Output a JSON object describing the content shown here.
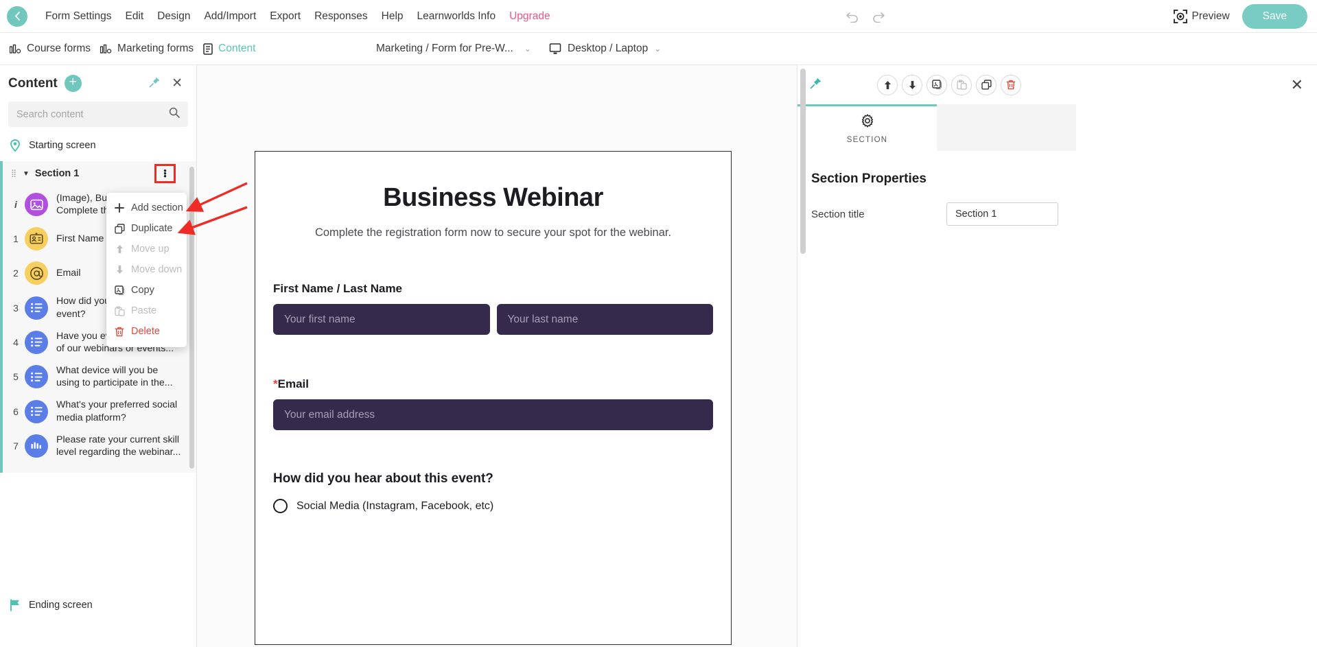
{
  "topbar": {
    "back_icon": "chevron-left-icon",
    "menu": [
      {
        "label": "Form Settings",
        "accent": false
      },
      {
        "label": "Edit",
        "accent": false
      },
      {
        "label": "Design",
        "accent": false
      },
      {
        "label": "Add/Import",
        "accent": false
      },
      {
        "label": "Export",
        "accent": false
      },
      {
        "label": "Responses",
        "accent": false
      },
      {
        "label": "Help",
        "accent": false
      },
      {
        "label": "Learnworlds Info",
        "accent": false
      },
      {
        "label": "Upgrade",
        "accent": true
      }
    ],
    "undo_icon": "undo-icon",
    "redo_icon": "redo-icon",
    "preview_label": "Preview",
    "preview_icon": "preview-focus-icon",
    "save_label": "Save",
    "accent_color": "#79ccc3",
    "upgrade_color": "#f0548c"
  },
  "subbar": {
    "course_forms": "Course forms",
    "marketing_forms": "Marketing forms",
    "content": "Content",
    "form_name": "Marketing / Form for Pre-W...",
    "device": "Desktop / Laptop"
  },
  "left_panel": {
    "title": "Content",
    "add_label": "+",
    "search_placeholder": "Search content",
    "search_value": "",
    "starting_screen": "Starting screen",
    "ending_screen": "Ending screen",
    "section": {
      "name": "Section 1",
      "items": [
        {
          "num": "i",
          "label": "(Image), Business Webinar,\nComplete the registra...",
          "color": "purple",
          "icon": "image-icon"
        },
        {
          "num": "1",
          "label": "First Name / Last Name",
          "color": "yellow",
          "icon": "id-card-icon"
        },
        {
          "num": "2",
          "label": "Email",
          "color": "yellow",
          "icon": "at-sign-icon"
        },
        {
          "num": "3",
          "label": "How did you hear about this\nevent?",
          "color": "blue",
          "icon": "list-icon"
        },
        {
          "num": "4",
          "label": "Have you ever been a part\nof our webinars or events...",
          "color": "blue",
          "icon": "list-icon"
        },
        {
          "num": "5",
          "label": "What device will you be\nusing to participate in the...",
          "color": "blue",
          "icon": "list-icon"
        },
        {
          "num": "6",
          "label": "What's your preferred social\nmedia platform?",
          "color": "blue",
          "icon": "list-icon"
        },
        {
          "num": "7",
          "label": "Please rate your current skill\nlevel regarding the webinar...",
          "color": "blue",
          "icon": "rating-icon"
        }
      ]
    }
  },
  "context_menu": {
    "items": [
      {
        "label": "Add section",
        "icon": "plus-icon",
        "state": "normal"
      },
      {
        "label": "Duplicate",
        "icon": "duplicate-icon",
        "state": "normal"
      },
      {
        "label": "Move up",
        "icon": "arrow-up-icon",
        "state": "disabled"
      },
      {
        "label": "Move down",
        "icon": "arrow-down-icon",
        "state": "disabled"
      },
      {
        "label": "Copy",
        "icon": "copy-icon",
        "state": "normal"
      },
      {
        "label": "Paste",
        "icon": "paste-icon",
        "state": "disabled"
      },
      {
        "label": "Delete",
        "icon": "trash-icon",
        "state": "danger"
      }
    ]
  },
  "form_preview": {
    "title": "Business Webinar",
    "subtitle": "Complete the registration form now to secure your spot for the webinar.",
    "name_label": "First Name / Last Name",
    "first_name_placeholder": "Your first name",
    "last_name_placeholder": "Your last name",
    "email_required_mark": "*",
    "email_label": "Email",
    "email_placeholder": "Your email address",
    "question_label": "How did you hear about this event?",
    "option_1": "Social Media (Instagram, Facebook, etc)",
    "input_bg_color": "#352a4c"
  },
  "right_panel": {
    "pin_icon": "pin-icon",
    "tools": [
      {
        "icon": "arrow-up-icon",
        "name": "move-up-button",
        "state": "normal"
      },
      {
        "icon": "arrow-down-icon",
        "name": "move-down-button",
        "state": "normal"
      },
      {
        "icon": "copy-icon",
        "name": "copy-button",
        "state": "normal"
      },
      {
        "icon": "paste-icon",
        "name": "paste-button",
        "state": "dim"
      },
      {
        "icon": "duplicate-icon",
        "name": "duplicate-button",
        "state": "normal"
      },
      {
        "icon": "trash-icon",
        "name": "delete-button",
        "state": "danger"
      }
    ],
    "tab_active_label": "SECTION",
    "tab_active_icon": "gear-icon",
    "heading": "Section Properties",
    "field_label": "Section title",
    "field_value": "Section 1"
  }
}
